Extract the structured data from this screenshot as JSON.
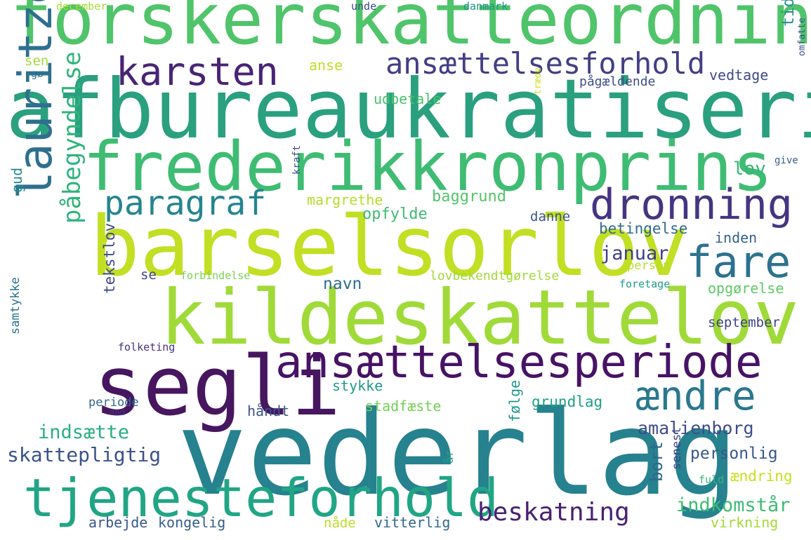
{
  "palette": {
    "background": "#ffffff",
    "darkPurple": "#45185d",
    "purple": "#482878",
    "indigo": "#3e4a89",
    "slateBlue": "#3b528b",
    "steelBlue": "#31688e",
    "teal": "#26828e",
    "tealGreen": "#1f9e89",
    "green": "#35b779",
    "mintGreen": "#50c46a",
    "lime": "#8fd744",
    "yellowGreen": "#bade28",
    "chartreuse": "#c8e020"
  },
  "words": [
    {
      "text": "forskerskatteordning",
      "color": "#50c46a"
    },
    {
      "text": "afbureaukratisering",
      "color": "#2aa07f"
    },
    {
      "text": "frederikkronprins",
      "color": "#3fbc73"
    },
    {
      "text": "barselsorlov",
      "color": "#c2df23"
    },
    {
      "text": "kildeskattelov",
      "color": "#a0da39"
    },
    {
      "text": "vederlag",
      "color": "#26828e"
    },
    {
      "text": "segli",
      "color": "#46175f"
    },
    {
      "text": "ansættelsesperiode",
      "color": "#471365"
    },
    {
      "text": "tjenesteforhold",
      "color": "#21a585"
    },
    {
      "text": "dronning",
      "color": "#453581"
    },
    {
      "text": "karsten",
      "color": "#482475"
    },
    {
      "text": "ansættelsesforhold",
      "color": "#433e85"
    },
    {
      "text": "lauritzen",
      "color": "#2e6f8e"
    },
    {
      "text": "fare",
      "color": "#2c728e"
    },
    {
      "text": "ændre",
      "color": "#2a788e"
    },
    {
      "text": "paragraf",
      "color": "#25858e"
    },
    {
      "text": "påbegyndelse",
      "color": "#2fb47c"
    },
    {
      "text": "beskatning",
      "color": "#482173"
    },
    {
      "text": "skattepligtig",
      "color": "#3b528b"
    },
    {
      "text": "indsætte",
      "color": "#29af7f"
    },
    {
      "text": "amalienborg",
      "color": "#3e4c8a"
    },
    {
      "text": "januar",
      "color": "#424086"
    },
    {
      "text": "indkomstår",
      "color": "#3dbc74"
    },
    {
      "text": "personlig",
      "color": "#38588c"
    },
    {
      "text": "betingelse",
      "color": "#306a8e"
    },
    {
      "text": "navn",
      "color": "#2f6c8e"
    },
    {
      "text": "kongelig",
      "color": "#355f8d"
    },
    {
      "text": "arbejde",
      "color": "#39568c"
    },
    {
      "text": "vitterlig",
      "color": "#31678e"
    },
    {
      "text": "september",
      "color": "#414287"
    },
    {
      "text": "opgørelse",
      "color": "#5ec962"
    },
    {
      "text": "håndt",
      "color": "#3b528b"
    },
    {
      "text": "baggrund",
      "color": "#52c569"
    },
    {
      "text": "opfylde",
      "color": "#3fbc73"
    },
    {
      "text": "margrethe",
      "color": "#b5de2b"
    },
    {
      "text": "udbetale",
      "color": "#4ac16d"
    },
    {
      "text": "lov",
      "color": "#35b779"
    },
    {
      "text": "anse",
      "color": "#bddf26"
    },
    {
      "text": "pågældende",
      "color": "#3d4e8a"
    },
    {
      "text": "vedtage",
      "color": "#3e4989"
    },
    {
      "text": "stykke",
      "color": "#1f9a8a"
    },
    {
      "text": "stadfæste",
      "color": "#73d056"
    },
    {
      "text": "grundlag",
      "color": "#1fa088"
    },
    {
      "text": "ændring",
      "color": "#c8e020"
    },
    {
      "text": "virkning",
      "color": "#a2da37"
    },
    {
      "text": "nåde",
      "color": "#bade28"
    },
    {
      "text": "danne",
      "color": "#3b528b"
    },
    {
      "text": "inden",
      "color": "#355f8d"
    },
    {
      "text": "gud",
      "color": "#24878e"
    },
    {
      "text": "tidlig",
      "color": "#228d8d"
    },
    {
      "text": "tekstlov",
      "color": "#3e4989"
    },
    {
      "text": "samtykke",
      "color": "#2c718e"
    },
    {
      "text": "følge",
      "color": "#1f968b"
    },
    {
      "text": "bort",
      "color": "#32658e"
    },
    {
      "text": "senest",
      "color": "#414487"
    },
    {
      "text": "periode",
      "color": "#31678e"
    },
    {
      "text": "folketing",
      "color": "#46327e"
    },
    {
      "text": "forbindelse",
      "color": "#7ad151"
    },
    {
      "text": "lovbekendtgørelse",
      "color": "#a2da37"
    },
    {
      "text": "person",
      "color": "#b5de2b"
    },
    {
      "text": "foretage",
      "color": "#1f9e89"
    },
    {
      "text": "se",
      "color": "#414487"
    },
    {
      "text": "december",
      "color": "#a5db36"
    },
    {
      "text": "unde",
      "color": "#3e4a89"
    },
    {
      "text": "danmark",
      "color": "#20928c"
    },
    {
      "text": "sen",
      "color": "#a0da39"
    },
    {
      "text": "gø",
      "color": "#2c728e"
    },
    {
      "text": "træde",
      "color": "#d2e21b"
    },
    {
      "text": "omfatte",
      "color": "#3b528b"
    },
    {
      "text": "give",
      "color": "#355f8d"
    },
    {
      "text": "kraft",
      "color": "#3b528b"
    },
    {
      "text": "and",
      "color": "#46337e"
    },
    {
      "text": "år",
      "color": "#1fa187"
    },
    {
      "text": "fuld",
      "color": "#35b779"
    }
  ]
}
